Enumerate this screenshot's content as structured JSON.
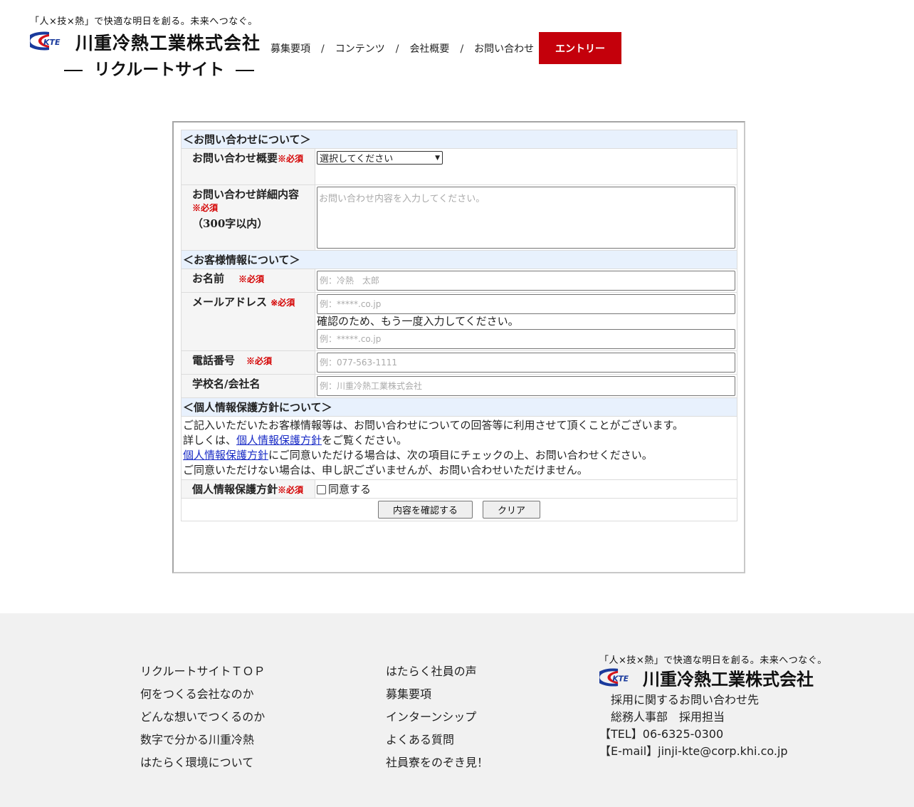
{
  "header": {
    "tagline": "「人×技×熱」で快適な明日を創る。未来へつなぐ。",
    "logo_text": "KTE",
    "company_name": "川重冷熱工業株式会社",
    "site_name": "リクルートサイト",
    "nav": [
      {
        "label": "募集要項"
      },
      {
        "label": "コンテンツ"
      },
      {
        "label": "会社概要"
      },
      {
        "label": "お問い合わせ"
      }
    ],
    "nav_separator": "/",
    "entry_button": "エントリー",
    "brand_color": "#c4000b"
  },
  "form": {
    "section_inquiry": "＜お問い合わせについて＞",
    "required_mark": "※必須",
    "summary_label": "お問い合わせ概要",
    "summary_select_value": "選択してください",
    "detail_label": "お問い合わせ詳細内容",
    "detail_note": "（300字以内）",
    "detail_placeholder": "お問い合わせ内容を入力してください。",
    "section_customer": "＜お客様情報について＞",
    "name_label": "お名前",
    "name_placeholder": "例：冷熱　太郎",
    "email_label": "メールアドレス",
    "email_placeholder": "例：*****.co.jp",
    "email_confirm_note": "確認のため、もう一度入力してください。",
    "email_confirm_placeholder": "例：*****.co.jp",
    "phone_label": "電話番号",
    "phone_placeholder": "例：077-563-1111",
    "company_label": "学校名/会社名",
    "company_placeholder": "例：川重冷熱工業株式会社",
    "section_privacy": "＜個人情報保護方針について＞",
    "privacy_line1": "ご記入いただいたお客様情報等は、お問い合わせについての回答等に利用させて頂くことがございます。",
    "privacy_line2_pre": "詳しくは、",
    "privacy_link": "個人情報保護方針",
    "privacy_line2_post": "をご覧ください。",
    "privacy_line3_post": "にご同意いただける場合は、次の項目にチェックの上、お問い合わせください。",
    "privacy_line4": "ご同意いただけない場合は、申し訳ございませんが、お問い合わせいただけません。",
    "privacy_label": "個人情報保護方針",
    "agree_label": "同意する",
    "confirm_button": "内容を確認する",
    "clear_button": "クリア",
    "required_color": "#d40000",
    "section_bg_color": "#e8f1fd"
  },
  "footer": {
    "col1": [
      "リクルートサイトＴＯＰ",
      "何をつくる会社なのか",
      "どんな想いでつくるのか",
      "数字で分かる川重冷熱",
      "はたらく環境について"
    ],
    "col2": [
      "はたらく社員の声",
      "募集要項",
      "インターンシップ",
      "よくある質問",
      "社員寮をのぞき見！"
    ],
    "tagline": "「人×技×熱」で快適な明日を創る。未来へつなぐ。",
    "company_name": "川重冷熱工業株式会社",
    "contact_title": "採用に関するお問い合わせ先",
    "department": "総務人事部　採用担当",
    "tel": "【TEL】06-6325-0300",
    "email": "【E-mail】jinji-kte@corp.khi.co.jp"
  }
}
